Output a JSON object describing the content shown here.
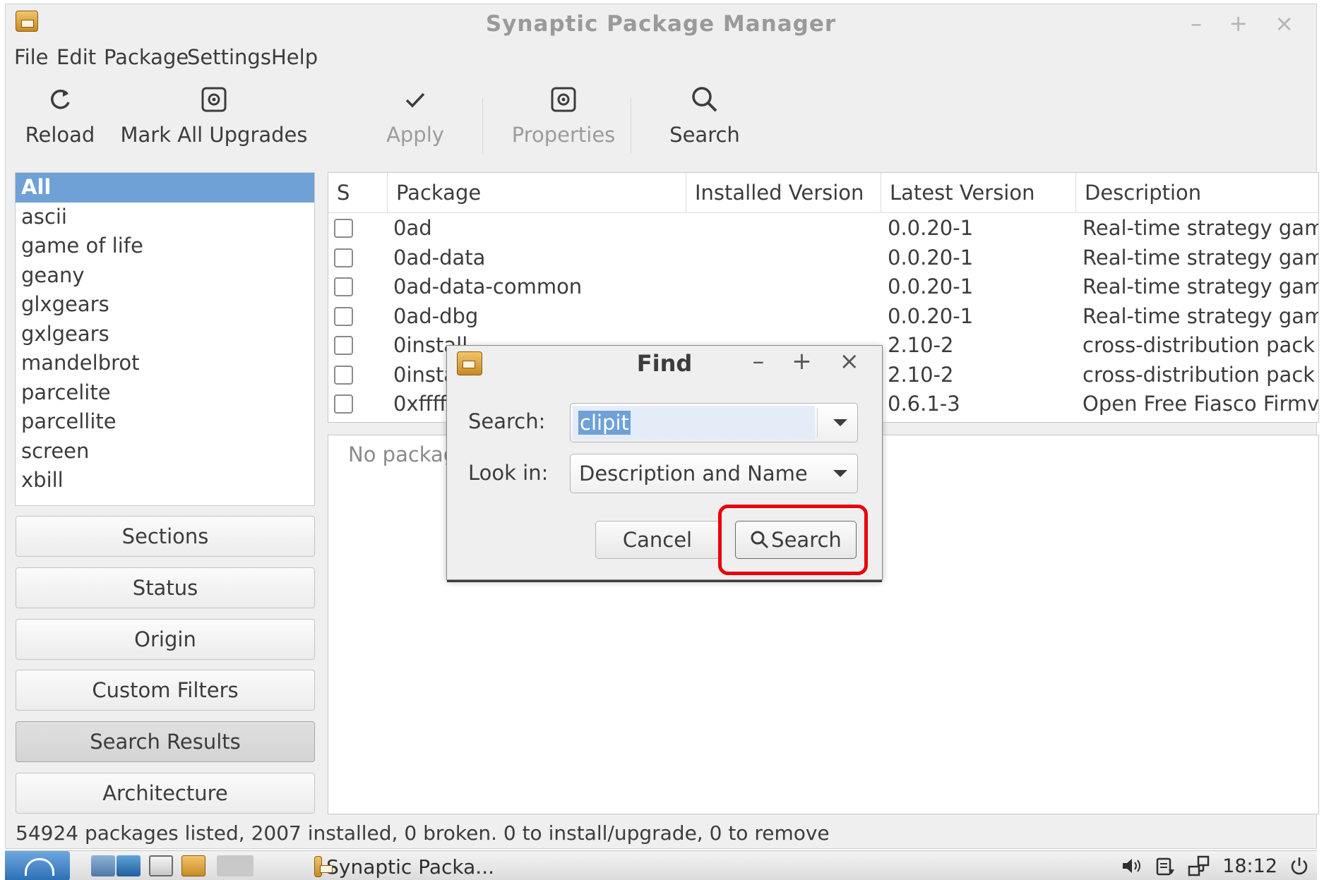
{
  "window": {
    "title": "Synaptic Package Manager",
    "controls": [
      "–",
      "+",
      "×"
    ]
  },
  "menu": [
    "File",
    "Edit",
    "Package",
    "Settings",
    "Help"
  ],
  "toolbar": [
    {
      "label": "Reload",
      "icon": "reload-icon",
      "enabled": true
    },
    {
      "label": "Mark All Upgrades",
      "icon": "gear-box-icon",
      "enabled": true
    },
    {
      "label": "Apply",
      "icon": "checkmark-icon",
      "enabled": false
    },
    {
      "label": "Properties",
      "icon": "gear-box-icon",
      "enabled": false
    },
    {
      "label": "Search",
      "icon": "search-icon",
      "enabled": true
    }
  ],
  "filters": {
    "selected": "All",
    "items": [
      "All",
      "ascii",
      "game of life",
      "geany",
      "glxgears",
      "gxlgears",
      "mandelbrot",
      "parcelite",
      "parcellite",
      "screen",
      "xbill"
    ]
  },
  "side_buttons": [
    {
      "label": "Sections",
      "active": false
    },
    {
      "label": "Status",
      "active": false
    },
    {
      "label": "Origin",
      "active": false
    },
    {
      "label": "Custom Filters",
      "active": false
    },
    {
      "label": "Search Results",
      "active": true
    },
    {
      "label": "Architecture",
      "active": false
    }
  ],
  "table": {
    "columns": [
      "S",
      "Package",
      "Installed Version",
      "Latest Version",
      "Description"
    ],
    "rows": [
      {
        "package": "0ad",
        "installed": "",
        "latest": "0.0.20-1",
        "description": "Real-time strategy gam"
      },
      {
        "package": "0ad-data",
        "installed": "",
        "latest": "0.0.20-1",
        "description": "Real-time strategy gam"
      },
      {
        "package": "0ad-data-common",
        "installed": "",
        "latest": "0.0.20-1",
        "description": "Real-time strategy gam"
      },
      {
        "package": "0ad-dbg",
        "installed": "",
        "latest": "0.0.20-1",
        "description": "Real-time strategy gam"
      },
      {
        "package": "0install",
        "installed": "",
        "latest": "2.10-2",
        "description": "cross-distribution pack"
      },
      {
        "package": "0insta",
        "installed": "",
        "latest": "2.10-2",
        "description": "cross-distribution pack"
      },
      {
        "package": "0xffff",
        "installed": "",
        "latest": "0.6.1-3",
        "description": "Open Free Fiasco Firmv"
      }
    ]
  },
  "details_text": "No packag",
  "status_bar": "54924 packages listed, 2007 installed, 0 broken. 0 to install/upgrade, 0 to remove",
  "find_dialog": {
    "title": "Find",
    "controls": [
      "–",
      "+",
      "×"
    ],
    "search_label": "Search:",
    "search_value": "clipit",
    "look_in_label": "Look in:",
    "look_in_value": "Description and Name",
    "cancel_label": "Cancel",
    "search_button_label": "Search",
    "highlight_color": "#e8000b"
  },
  "taskbar": {
    "task_label": "Synaptic Packa...",
    "clock": "18:12"
  },
  "colors": {
    "selection": "#6fa1d6",
    "window_bg": "#efefef"
  }
}
